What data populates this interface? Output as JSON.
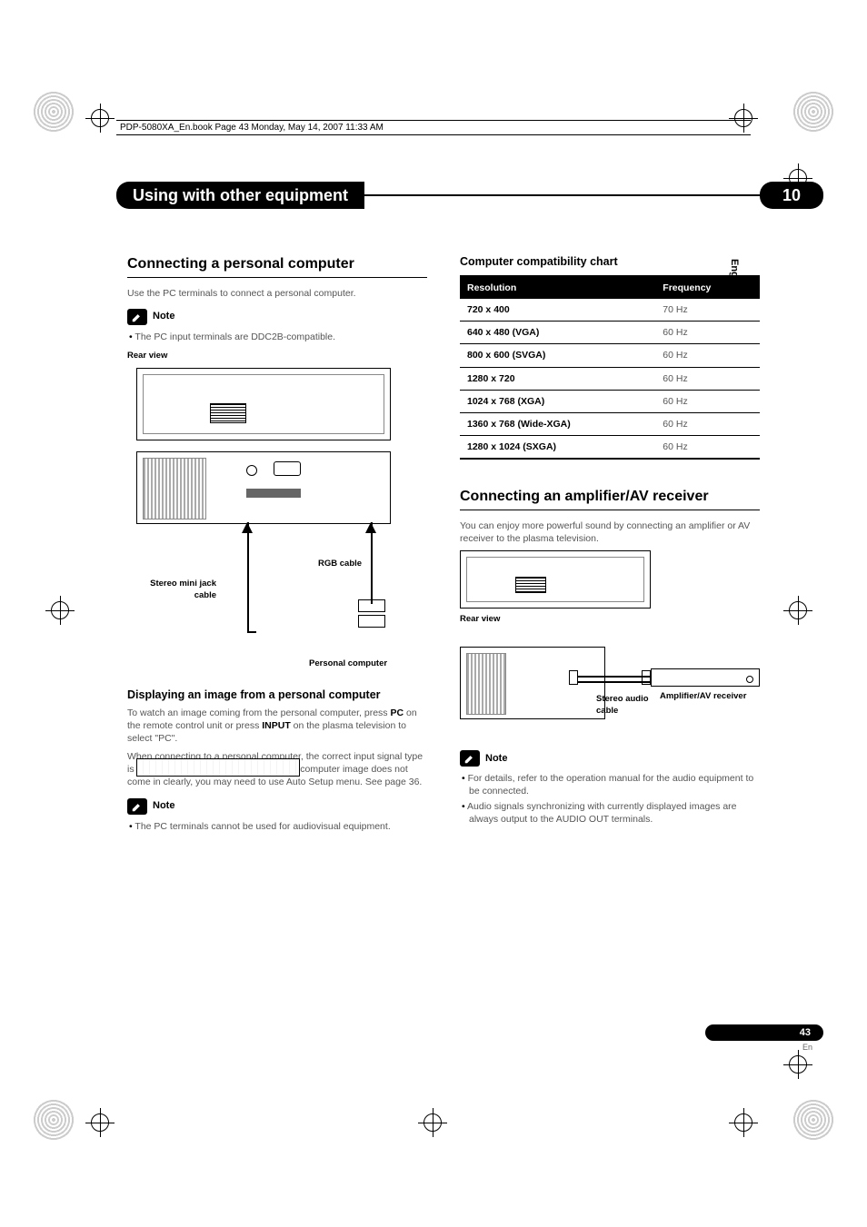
{
  "header": {
    "running": "PDP-5080XA_En.book  Page 43  Monday, May 14, 2007  11:33 AM"
  },
  "chapter": {
    "title": "Using with other equipment",
    "number": "10"
  },
  "sideTab": "English",
  "left": {
    "h2": "Connecting a personal computer",
    "intro": "Use the PC terminals to connect a personal computer.",
    "noteLabel": "Note",
    "note1": "The PC input terminals are DDC2B-compatible.",
    "rearView": "Rear view",
    "lbl_stereo": "Stereo mini jack cable",
    "lbl_rgb": "RGB cable",
    "lbl_pc": "Personal computer",
    "h3": "Displaying an image from a personal computer",
    "body1a": "To watch an image coming from the personal computer, press ",
    "body1b": "PC",
    "body1c": " on the remote control unit or press ",
    "body1d": "INPUT",
    "body1e": " on the plasma television to select \"PC\".",
    "body2": "When connecting to a personal computer, the correct input signal type is automatically detected. If the personal computer image does not come in clearly, you may need to use Auto Setup menu. See page 36.",
    "note2": "The PC terminals cannot be used for audiovisual equipment."
  },
  "right": {
    "h3compat": "Computer compatibility chart",
    "th_res": "Resolution",
    "th_freq": "Frequency",
    "h2amp": "Connecting an amplifier/AV receiver",
    "ampIntro": "You can enjoy more powerful sound by connecting an amplifier or AV receiver to the plasma television.",
    "rearView": "Rear view",
    "lbl_stereoAudio": "Stereo audio cable",
    "lbl_amp": "Amplifier/AV receiver",
    "noteLabel": "Note",
    "ampNote1": "For details, refer to the operation manual for the audio equipment to be connected.",
    "ampNote2": "Audio signals synchronizing with currently displayed images are always output to the AUDIO OUT terminals."
  },
  "chart_data": {
    "type": "table",
    "columns": [
      "Resolution",
      "Frequency"
    ],
    "rows": [
      [
        "720 x 400",
        "70 Hz"
      ],
      [
        "640 x 480 (VGA)",
        "60 Hz"
      ],
      [
        "800 x 600 (SVGA)",
        "60 Hz"
      ],
      [
        "1280 x 720",
        "60 Hz"
      ],
      [
        "1024 x 768 (XGA)",
        "60 Hz"
      ],
      [
        "1360 x 768 (Wide-XGA)",
        "60 Hz"
      ],
      [
        "1280 x 1024 (SXGA)",
        "60 Hz"
      ]
    ]
  },
  "footer": {
    "pageNum": "43",
    "lang": "En"
  }
}
